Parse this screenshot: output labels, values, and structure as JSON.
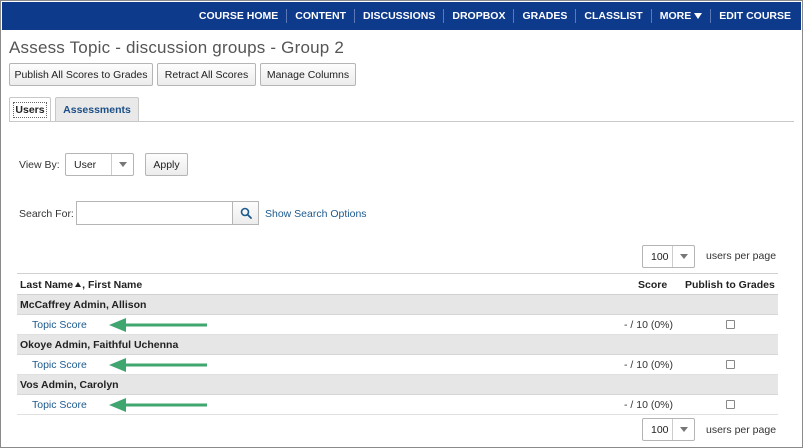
{
  "nav": {
    "items": [
      "COURSE HOME",
      "CONTENT",
      "DISCUSSIONS",
      "DROPBOX",
      "GRADES",
      "CLASSLIST",
      "MORE",
      "EDIT COURSE"
    ]
  },
  "page": {
    "title": "Assess Topic - discussion groups - Group 2"
  },
  "toolbar": {
    "publish_label": "Publish All Scores to Grades",
    "retract_label": "Retract All Scores",
    "manage_label": "Manage Columns"
  },
  "tabs": [
    {
      "label": "Users",
      "active": true
    },
    {
      "label": "Assessments",
      "active": false
    }
  ],
  "view_by": {
    "label": "View By:",
    "value": "User",
    "apply_label": "Apply"
  },
  "search": {
    "label": "Search For:",
    "value": "",
    "options_link": "Show Search Options"
  },
  "paging": {
    "per_page": "100",
    "per_page_label": "users per page"
  },
  "table": {
    "col_name": "Last Name",
    "col_name_rest": ", First Name",
    "col_score": "Score",
    "col_publish": "Publish to Grades",
    "groups": [
      {
        "name": "McCaffrey Admin, Allison",
        "topic": "Topic Score",
        "score": "- / 10 (0%)"
      },
      {
        "name": "Okoye Admin, Faithful Uchenna",
        "topic": "Topic Score",
        "score": "- / 10 (0%)"
      },
      {
        "name": "Vos Admin, Carolyn",
        "topic": "Topic Score",
        "score": "- / 10 (0%)"
      }
    ]
  },
  "colors": {
    "nav_bg": "#0e3a8c",
    "link": "#1c5a8e",
    "annotation_arrow": "#3fa66f"
  }
}
